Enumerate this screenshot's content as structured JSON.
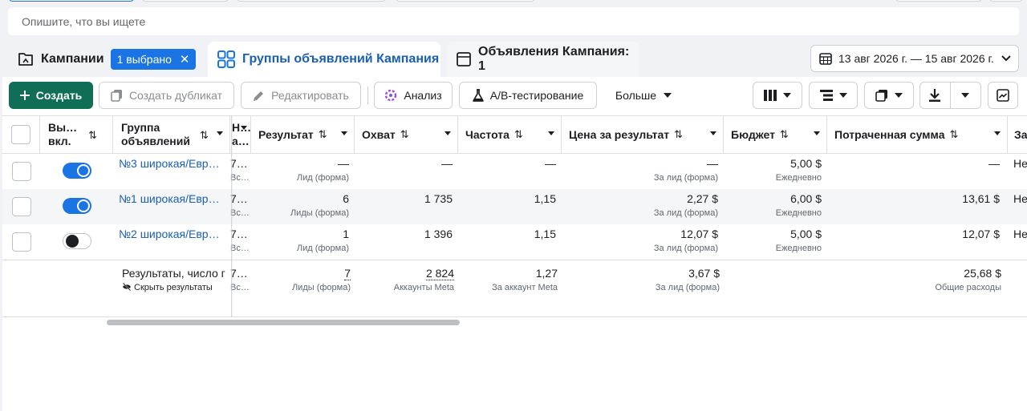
{
  "search": {
    "placeholder": "Опишите, что вы ищете"
  },
  "tabs": {
    "campaigns": {
      "label": "Кампании",
      "chip": "1 выбрано",
      "chip_close": "✕"
    },
    "adsets": {
      "label": "Группы объявлений Кампания"
    },
    "ads": {
      "label": "Объявления Кампания: 1"
    }
  },
  "date_range": "13 авг 2026 г. — 15 авг 2026 г.",
  "toolbar": {
    "create": "Создать",
    "duplicate": "Создать дубликат",
    "edit": "Редактировать",
    "analysis": "Анализ",
    "ab_test": "A/B-тестирование",
    "more": "Больше"
  },
  "columns": {
    "onoff": "Вы… вкл.",
    "onoff_1": "Вы…",
    "onoff_2": "вкл.",
    "adset_1": "Группа",
    "adset_2": "объявлений",
    "delivery_1": "Н…",
    "delivery_2": "а…",
    "result": "Результат",
    "reach": "Охват",
    "frequency": "Частота",
    "cost_per_result": "Цена за результат",
    "budget": "Бюджет",
    "amount_spent": "Потраченная сумма",
    "ends": "За"
  },
  "rows": [
    {
      "enabled": true,
      "name": "№3 широкая/Евр…",
      "delivery_1": "7…",
      "delivery_2": "Вс…",
      "result": "—",
      "result_sub": "Лид (форма)",
      "reach": "—",
      "frequency": "—",
      "cost": "—",
      "cost_sub": "За лид (форма)",
      "budget": "5,00 $",
      "budget_sub": "Ежедневно",
      "spent": "—",
      "ends": "Не"
    },
    {
      "enabled": true,
      "name": "№1 широкая/Евр…",
      "delivery_1": "7…",
      "delivery_2": "Вс…",
      "result": "6",
      "result_sub": "Лиды (форма)",
      "reach": "1 735",
      "frequency": "1,15",
      "cost": "2,27 $",
      "cost_sub": "За лид (форма)",
      "budget": "6,00 $",
      "budget_sub": "Ежедневно",
      "spent": "13,61 $",
      "ends": "Не"
    },
    {
      "enabled": false,
      "name": "№2 широкая/Евр…",
      "delivery_1": "7…",
      "delivery_2": "Вс…",
      "result": "1",
      "result_sub": "Лид (форма)",
      "reach": "1 396",
      "frequency": "1,15",
      "cost": "12,07 $",
      "cost_sub": "За лид (форма)",
      "budget": "5,00 $",
      "budget_sub": "Ежедневно",
      "spent": "12,07 $",
      "ends": "Не"
    }
  ],
  "summary": {
    "label": "Результаты, число г",
    "hide": "Скрыть результаты",
    "delivery_1": "7…",
    "delivery_2": "Вс…",
    "result": "7",
    "result_sub": "Лиды (форма)",
    "reach": "2 824",
    "reach_sub": "Аккаунты Meta",
    "frequency": "1,27",
    "frequency_sub": "За аккаунт Meta",
    "cost": "3,67 $",
    "cost_sub": "За лид (форма)",
    "spent": "25,68 $",
    "spent_sub": "Общие расходы"
  },
  "colors": {
    "accent": "#1b74e4",
    "create": "#0f6e55",
    "link": "#1a5fb4"
  }
}
